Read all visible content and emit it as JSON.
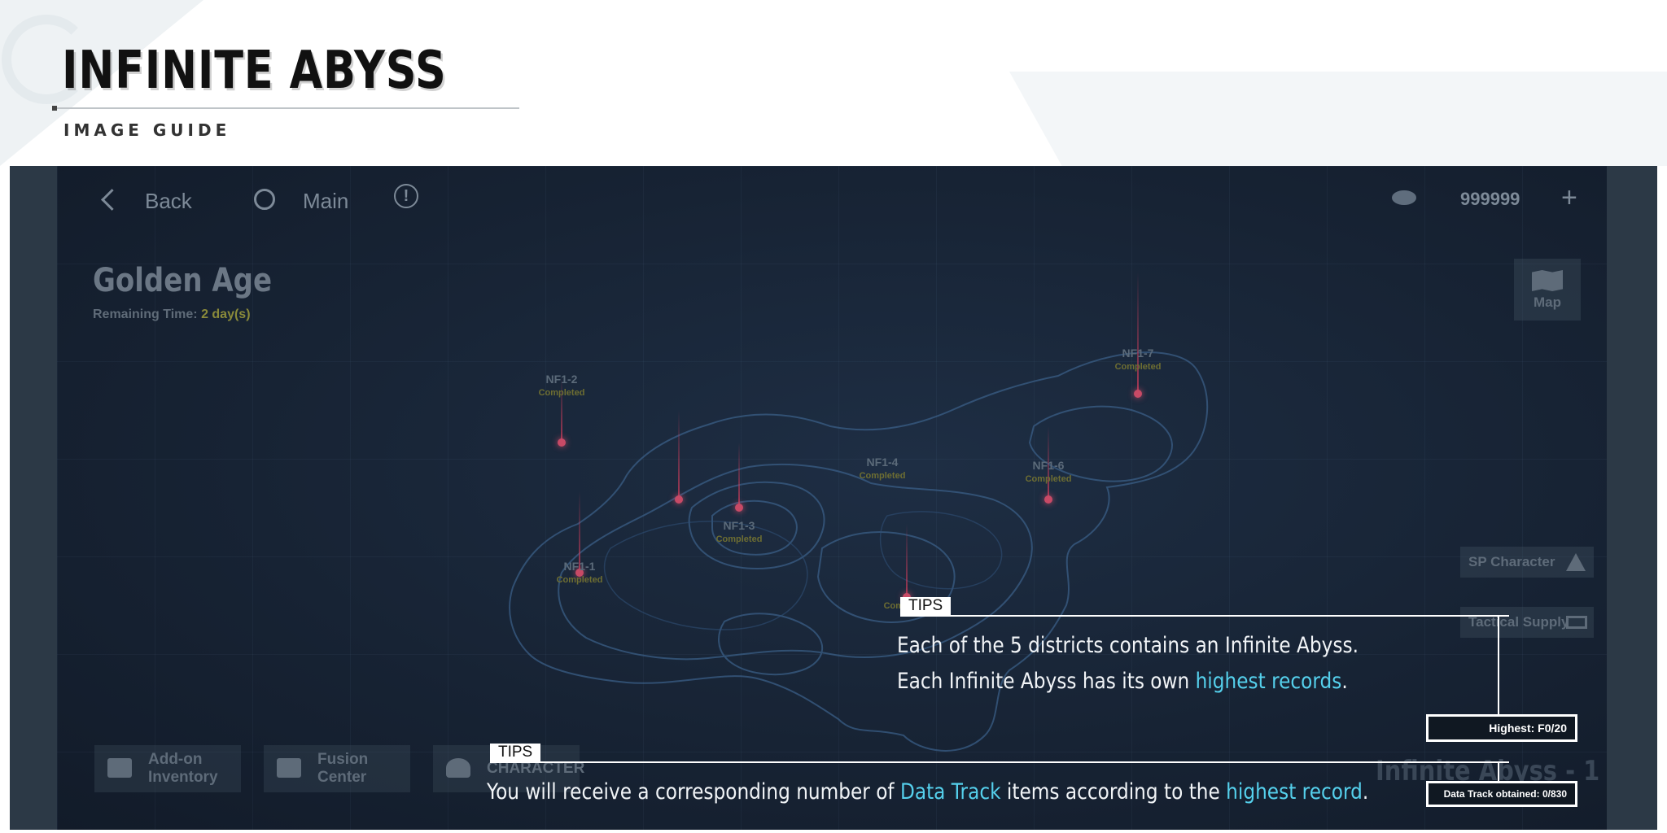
{
  "guide": {
    "title": "INFINITE ABYSS",
    "subtitle": "IMAGE GUIDE"
  },
  "topbar": {
    "back_label": "Back",
    "main_label": "Main",
    "info_symbol": "!",
    "currency_value": "999999",
    "plus_symbol": "+"
  },
  "stage": {
    "title": "Golden Age",
    "remaining_prefix": "Remaining Time: ",
    "remaining_value": "2 day(s)"
  },
  "side_buttons": {
    "map": "Map",
    "sp_character": "SP Character",
    "tactical_supply": "Tactical Supply"
  },
  "bottom_buttons": [
    {
      "line1": "Add-on",
      "line2": "Inventory"
    },
    {
      "line1": "Fusion",
      "line2": "Center"
    },
    {
      "line1": "CHARACTER",
      "line2": ""
    }
  ],
  "abyss_label": "Infinite Abyss - 1",
  "nodes": [
    {
      "code": "NF1-2",
      "status": "Completed"
    },
    {
      "code": "NF1-7",
      "status": "Completed"
    },
    {
      "code": "NF1-4",
      "status": "Completed"
    },
    {
      "code": "NF1-6",
      "status": "Completed"
    },
    {
      "code": "NF1-3",
      "status": "Completed"
    },
    {
      "code": "NF1-1",
      "status": "Completed"
    },
    {
      "code": "",
      "status": "Completed"
    }
  ],
  "tips": [
    {
      "tag": "TIPS",
      "line1": "Each of the 5 districts contains an Infinite Abyss.",
      "line2_pre": "Each Infinite Abyss has its own ",
      "line2_hl": "highest records",
      "line2_post": ".",
      "box": "Highest: F0/20"
    },
    {
      "tag": "TIPS",
      "pre": "You will receive a corresponding number of ",
      "hl1": "Data Track",
      "mid": " items according to the ",
      "hl2": "highest record",
      "post": ".",
      "box": "Data Track obtained: 0/830"
    }
  ],
  "colors": {
    "highlight": "#55d0ec",
    "game_bg": "#172334",
    "pin": "#c84a66"
  }
}
